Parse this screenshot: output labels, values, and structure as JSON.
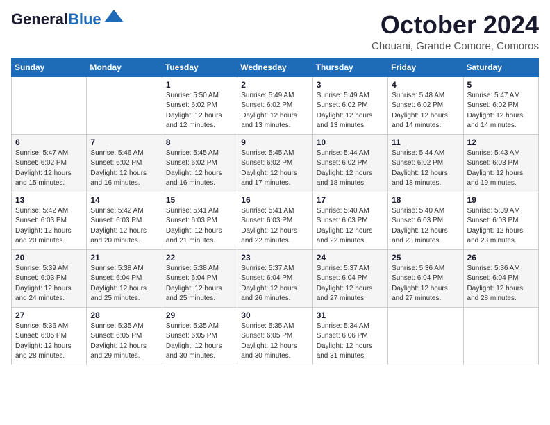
{
  "logo": {
    "line1": "General",
    "line2": "Blue"
  },
  "header": {
    "title": "October 2024",
    "location": "Chouani, Grande Comore, Comoros"
  },
  "weekdays": [
    "Sunday",
    "Monday",
    "Tuesday",
    "Wednesday",
    "Thursday",
    "Friday",
    "Saturday"
  ],
  "weeks": [
    [
      {
        "day": "",
        "info": ""
      },
      {
        "day": "",
        "info": ""
      },
      {
        "day": "1",
        "info": "Sunrise: 5:50 AM\nSunset: 6:02 PM\nDaylight: 12 hours\nand 12 minutes."
      },
      {
        "day": "2",
        "info": "Sunrise: 5:49 AM\nSunset: 6:02 PM\nDaylight: 12 hours\nand 13 minutes."
      },
      {
        "day": "3",
        "info": "Sunrise: 5:49 AM\nSunset: 6:02 PM\nDaylight: 12 hours\nand 13 minutes."
      },
      {
        "day": "4",
        "info": "Sunrise: 5:48 AM\nSunset: 6:02 PM\nDaylight: 12 hours\nand 14 minutes."
      },
      {
        "day": "5",
        "info": "Sunrise: 5:47 AM\nSunset: 6:02 PM\nDaylight: 12 hours\nand 14 minutes."
      }
    ],
    [
      {
        "day": "6",
        "info": "Sunrise: 5:47 AM\nSunset: 6:02 PM\nDaylight: 12 hours\nand 15 minutes."
      },
      {
        "day": "7",
        "info": "Sunrise: 5:46 AM\nSunset: 6:02 PM\nDaylight: 12 hours\nand 16 minutes."
      },
      {
        "day": "8",
        "info": "Sunrise: 5:45 AM\nSunset: 6:02 PM\nDaylight: 12 hours\nand 16 minutes."
      },
      {
        "day": "9",
        "info": "Sunrise: 5:45 AM\nSunset: 6:02 PM\nDaylight: 12 hours\nand 17 minutes."
      },
      {
        "day": "10",
        "info": "Sunrise: 5:44 AM\nSunset: 6:02 PM\nDaylight: 12 hours\nand 18 minutes."
      },
      {
        "day": "11",
        "info": "Sunrise: 5:44 AM\nSunset: 6:02 PM\nDaylight: 12 hours\nand 18 minutes."
      },
      {
        "day": "12",
        "info": "Sunrise: 5:43 AM\nSunset: 6:03 PM\nDaylight: 12 hours\nand 19 minutes."
      }
    ],
    [
      {
        "day": "13",
        "info": "Sunrise: 5:42 AM\nSunset: 6:03 PM\nDaylight: 12 hours\nand 20 minutes."
      },
      {
        "day": "14",
        "info": "Sunrise: 5:42 AM\nSunset: 6:03 PM\nDaylight: 12 hours\nand 20 minutes."
      },
      {
        "day": "15",
        "info": "Sunrise: 5:41 AM\nSunset: 6:03 PM\nDaylight: 12 hours\nand 21 minutes."
      },
      {
        "day": "16",
        "info": "Sunrise: 5:41 AM\nSunset: 6:03 PM\nDaylight: 12 hours\nand 22 minutes."
      },
      {
        "day": "17",
        "info": "Sunrise: 5:40 AM\nSunset: 6:03 PM\nDaylight: 12 hours\nand 22 minutes."
      },
      {
        "day": "18",
        "info": "Sunrise: 5:40 AM\nSunset: 6:03 PM\nDaylight: 12 hours\nand 23 minutes."
      },
      {
        "day": "19",
        "info": "Sunrise: 5:39 AM\nSunset: 6:03 PM\nDaylight: 12 hours\nand 23 minutes."
      }
    ],
    [
      {
        "day": "20",
        "info": "Sunrise: 5:39 AM\nSunset: 6:03 PM\nDaylight: 12 hours\nand 24 minutes."
      },
      {
        "day": "21",
        "info": "Sunrise: 5:38 AM\nSunset: 6:04 PM\nDaylight: 12 hours\nand 25 minutes."
      },
      {
        "day": "22",
        "info": "Sunrise: 5:38 AM\nSunset: 6:04 PM\nDaylight: 12 hours\nand 25 minutes."
      },
      {
        "day": "23",
        "info": "Sunrise: 5:37 AM\nSunset: 6:04 PM\nDaylight: 12 hours\nand 26 minutes."
      },
      {
        "day": "24",
        "info": "Sunrise: 5:37 AM\nSunset: 6:04 PM\nDaylight: 12 hours\nand 27 minutes."
      },
      {
        "day": "25",
        "info": "Sunrise: 5:36 AM\nSunset: 6:04 PM\nDaylight: 12 hours\nand 27 minutes."
      },
      {
        "day": "26",
        "info": "Sunrise: 5:36 AM\nSunset: 6:04 PM\nDaylight: 12 hours\nand 28 minutes."
      }
    ],
    [
      {
        "day": "27",
        "info": "Sunrise: 5:36 AM\nSunset: 6:05 PM\nDaylight: 12 hours\nand 28 minutes."
      },
      {
        "day": "28",
        "info": "Sunrise: 5:35 AM\nSunset: 6:05 PM\nDaylight: 12 hours\nand 29 minutes."
      },
      {
        "day": "29",
        "info": "Sunrise: 5:35 AM\nSunset: 6:05 PM\nDaylight: 12 hours\nand 30 minutes."
      },
      {
        "day": "30",
        "info": "Sunrise: 5:35 AM\nSunset: 6:05 PM\nDaylight: 12 hours\nand 30 minutes."
      },
      {
        "day": "31",
        "info": "Sunrise: 5:34 AM\nSunset: 6:06 PM\nDaylight: 12 hours\nand 31 minutes."
      },
      {
        "day": "",
        "info": ""
      },
      {
        "day": "",
        "info": ""
      }
    ]
  ]
}
